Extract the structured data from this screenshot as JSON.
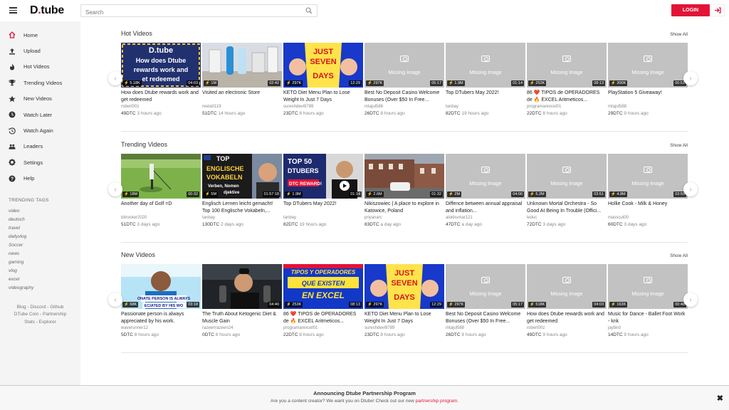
{
  "header": {
    "logo_text": "D",
    "logo_dot": ".",
    "logo_rest": "tube",
    "search_placeholder": "Search",
    "login_label": "LOGIN"
  },
  "sidebar": {
    "items": [
      {
        "label": "Home",
        "icon": "home-icon"
      },
      {
        "label": "Upload",
        "icon": "upload-icon"
      },
      {
        "label": "Hot Videos",
        "icon": "fire-icon"
      },
      {
        "label": "Trending Videos",
        "icon": "trophy-icon"
      },
      {
        "label": "New Videos",
        "icon": "star-icon"
      },
      {
        "label": "Watch Later",
        "icon": "clock-icon"
      },
      {
        "label": "Watch Again",
        "icon": "history-icon"
      },
      {
        "label": "Leaders",
        "icon": "users-icon"
      },
      {
        "label": "Settings",
        "icon": "gear-icon"
      },
      {
        "label": "Help",
        "icon": "question-icon"
      }
    ],
    "tags_title": "TRENDING TAGS",
    "tags": [
      "video",
      "deutsch",
      "travel",
      "dailyvlog",
      "Soccer",
      "news",
      "gaming",
      "vlog",
      "excel",
      "videography"
    ],
    "footer_line1": "Blog - Discord - Github",
    "footer_line2": "DTube Coin - Partnership",
    "footer_line3": "Stats - Explorer"
  },
  "sections": [
    {
      "title": "Hot Videos",
      "show_all": "Show All",
      "videos": [
        {
          "title": "How does Dtube rewards work and get redeemed",
          "author": "robert00z",
          "dtc": "49DTC",
          "ago": "3 hours ago",
          "value": "5.18K",
          "duration": "04:03",
          "thumb": "dtube"
        },
        {
          "title": "Visited an electronic Store",
          "author": "reeta0119",
          "dtc": "51DTC",
          "ago": "14 hours ago",
          "value": "1M",
          "duration": "02:42",
          "thumb": "store"
        },
        {
          "title": "KETO Diet Menu Plan to Lose Weight In Just 7 Days",
          "author": "sureshdevi9789",
          "dtc": "23DTC",
          "ago": "8 hours ago",
          "value": "297K",
          "duration": "12:29",
          "thumb": "keto"
        },
        {
          "title": "Best No Deposit Casino Welcome Bonuses (Over $50 In Free...",
          "author": "mtajul588",
          "dtc": "26DTC",
          "ago": "8 hours ago",
          "value": "297K",
          "duration": "05:17",
          "thumb": "missing"
        },
        {
          "title": "Top DTubers May 2022!",
          "author": "tanbay",
          "dtc": "82DTC",
          "ago": "19 hours ago",
          "value": "1.9M",
          "duration": "01:14",
          "thumb": "missing"
        },
        {
          "title": "86 ❤️ TIPOS de OPERADORES de 🔥 EXCEL Aritmeticos...",
          "author": "programarexcel01",
          "dtc": "22DTC",
          "ago": "8 hours ago",
          "value": "253K",
          "duration": "08:13",
          "thumb": "missing"
        },
        {
          "title": "PlayStation 5 Giveaway!",
          "author": "mtajul588",
          "dtc": "29DTC",
          "ago": "9 hours ago",
          "value": "300K",
          "duration": "00:51",
          "thumb": "missing"
        }
      ]
    },
    {
      "title": "Trending Videos",
      "show_all": "Show All",
      "videos": [
        {
          "title": "Another day of Golf =D",
          "author": "bitrocker2020",
          "dtc": "51DTC",
          "ago": "3 days ago",
          "value": "18M",
          "duration": "00:32",
          "thumb": "golf"
        },
        {
          "title": "Englisch Lernen leicht gemacht! Top 100 Englische Vokabeln,...",
          "author": "tanbay",
          "dtc": "130DTC",
          "ago": "2 days ago",
          "value": "5M",
          "duration": "01:57:18",
          "thumb": "english"
        },
        {
          "title": "Top DTubers May 2022!",
          "author": "tanbay",
          "dtc": "82DTC",
          "ago": "19 hours ago",
          "value": "1.9M",
          "duration": "01:14",
          "thumb": "top50"
        },
        {
          "title": "Nikiszowiec | A place to explore in Katowice, Poland",
          "author": "priyanarc",
          "dtc": "83DTC",
          "ago": "a day ago",
          "value": "2.6M",
          "duration": "01:32",
          "thumb": "street"
        },
        {
          "title": "Diffence between annual appraisal and inflation...",
          "author": "alokkumar121",
          "dtc": "47DTC",
          "ago": "a day ago",
          "value": "2M",
          "duration": "04:00",
          "thumb": "missing"
        },
        {
          "title": "Unknown Mortal Orchestra - So Good At Being In Trouble (Offici...",
          "author": "leduc",
          "dtc": "72DTC",
          "ago": "3 days ago",
          "value": "5.2M",
          "duration": "03:51",
          "thumb": "missing"
        },
        {
          "title": "Hollie Cook - Milk & Honey",
          "author": "masscut00",
          "dtc": "60DTC",
          "ago": "3 days ago",
          "value": "4.8M",
          "duration": "03:55",
          "thumb": "missing"
        }
      ]
    },
    {
      "title": "New Videos",
      "show_all": "Show All",
      "videos": [
        {
          "title": "Passionate person is always appreciated by his work.",
          "author": "waverunner12",
          "dtc": "5DTC",
          "ago": "8 hours ago",
          "value": "68K",
          "duration": "03:18",
          "thumb": "passion"
        },
        {
          "title": "The Truth About Ketogenic Diet & Muscle Gain",
          "author": "razeenrazeen24",
          "dtc": "0DTC",
          "ago": "8 hours ago",
          "value": "",
          "duration": "04:40",
          "thumb": "podcast"
        },
        {
          "title": "86 ❤️ TIPOS de OPERADORES de 🔥 EXCEL Aritmeticos...",
          "author": "programarexcel01",
          "dtc": "22DTC",
          "ago": "8 hours ago",
          "value": "253K",
          "duration": "08:13",
          "thumb": "tipos"
        },
        {
          "title": "KETO Diet Menu Plan to Lose Weight In Just 7 Days",
          "author": "sureshdevi9789",
          "dtc": "23DTC",
          "ago": "8 hours ago",
          "value": "297K",
          "duration": "12:29",
          "thumb": "keto"
        },
        {
          "title": "Best No Deposit Casino Welcome Bonuses (Over $50 In Free...",
          "author": "mtajul588",
          "dtc": "26DTC",
          "ago": "8 hours ago",
          "value": "297K",
          "duration": "05:17",
          "thumb": "missing"
        },
        {
          "title": "How does Dtube rewards work and get redeemed",
          "author": "robert00z",
          "dtc": "49DTC",
          "ago": "9 hours ago",
          "value": "518K",
          "duration": "04:03",
          "thumb": "missing"
        },
        {
          "title": "Music for Dance - Ballet Foot Work - knk",
          "author": "jaybird",
          "dtc": "14DTC",
          "ago": "9 hours ago",
          "value": "163K",
          "duration": "00:48",
          "thumb": "missing"
        }
      ]
    }
  ],
  "thumb_texts": {
    "dtube_l1": "D.tube",
    "dtube_l2": "How does Dtube",
    "dtube_l3": "rewards work and",
    "dtube_l4": "et redeemed",
    "keto_l1": "JUST",
    "keto_l2": "SEVEN",
    "keto_l3": "DAYS",
    "english_l1": "TOP",
    "english_l2": "ENGLISCHE",
    "english_l3": "VOKABELN",
    "english_l4": "Verben, Nomen",
    "english_l5": "djektive",
    "top50_l1": "TOP 50",
    "top50_l2": "DTUBERS",
    "top50_l3": "DTC REWARD!",
    "tipos_l1": "TIPOS Y OPERADORES",
    "tipos_l2": "QUE EXISTEN",
    "tipos_l3": "EN EXCEL",
    "passion_l1": "ONATE PERSON IS ALWAYS",
    "passion_l2": "ECIATED BY HIS WO",
    "missing": "Missing Image"
  },
  "announcement": {
    "title": "Announcing Dtube Partnership Program",
    "text": "Are you a content creator? We want you on Dtube! Check out our new ",
    "link": "partnership program",
    "end": "."
  },
  "colors": {
    "brand": "#e31337",
    "sidebar_bg": "#f4f4f4",
    "missing_thumb": "#c2c2c2"
  }
}
